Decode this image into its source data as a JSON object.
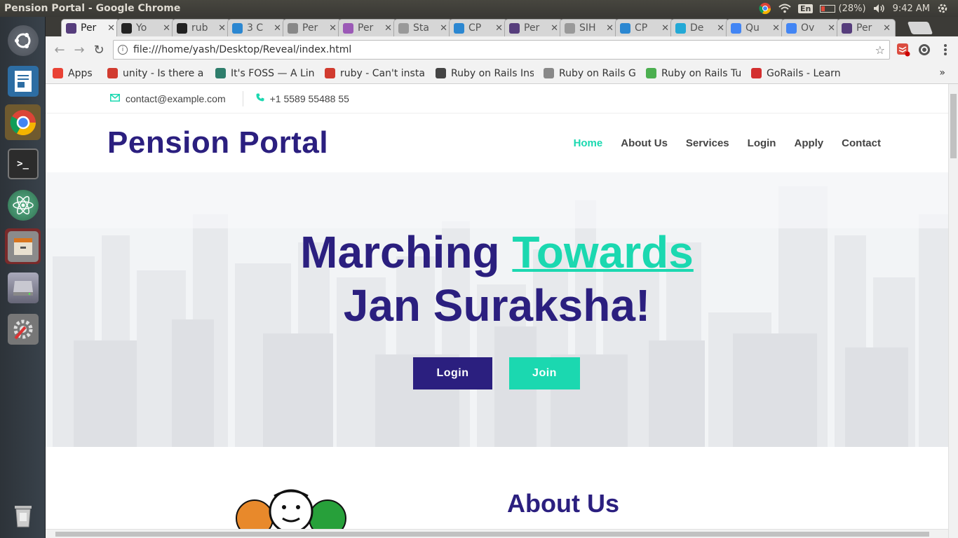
{
  "system": {
    "window_title": "Pension Portal - Google Chrome",
    "keyboard_lang": "En",
    "battery": "(28%)",
    "clock": "9:42 AM"
  },
  "launcher": {
    "items": [
      "ubuntu-dash",
      "libreoffice-writer",
      "chrome",
      "terminal",
      "atom",
      "file-manager",
      "disk-drive",
      "system-settings",
      "trash"
    ]
  },
  "browser": {
    "tabs": [
      {
        "label": "Per",
        "icon": "bootstrap-icon",
        "color": "#563d7c",
        "active": true
      },
      {
        "label": "Yo",
        "icon": "youtube-icon",
        "color": "#222222"
      },
      {
        "label": "rub",
        "icon": "github-icon",
        "color": "#222222"
      },
      {
        "label": "3 C",
        "icon": "mdb-icon",
        "color": "#2b87d1"
      },
      {
        "label": "Per",
        "icon": "emblem-icon",
        "color": "#888888"
      },
      {
        "label": "Per",
        "icon": "pension-icon",
        "color": "#9b59b6"
      },
      {
        "label": "Sta",
        "icon": "page-icon",
        "color": "#999999"
      },
      {
        "label": "CP",
        "icon": "cpanel-icon",
        "color": "#2b87d1"
      },
      {
        "label": "Per",
        "icon": "bootstrap-icon",
        "color": "#563d7c"
      },
      {
        "label": "SIH",
        "icon": "page-icon",
        "color": "#999999"
      },
      {
        "label": "CP",
        "icon": "cpanel-icon",
        "color": "#2b87d1"
      },
      {
        "label": "De",
        "icon": "m-icon",
        "color": "#23a9d6"
      },
      {
        "label": "Qu",
        "icon": "google-icon",
        "color": "#4285f4"
      },
      {
        "label": "Ov",
        "icon": "google-icon",
        "color": "#4285f4"
      },
      {
        "label": "Per",
        "icon": "bootstrap-icon",
        "color": "#563d7c"
      }
    ],
    "url": "file:///home/yash/Desktop/Reveal/index.html",
    "bookmarks": [
      {
        "label": "Apps",
        "icon": "apps-grid-icon"
      },
      {
        "label": "unity - Is there a",
        "icon": "askubuntu-icon"
      },
      {
        "label": "It's FOSS — A Lin",
        "icon": "itsfoss-icon"
      },
      {
        "label": "ruby - Can't insta",
        "icon": "askubuntu-icon"
      },
      {
        "label": "Ruby on Rails Ins",
        "icon": "diamond-icon"
      },
      {
        "label": "Ruby on Rails Gu",
        "icon": "page-icon"
      },
      {
        "label": "Ruby on Rails Tu",
        "icon": "tutorial-icon"
      },
      {
        "label": "GoRails - Learn R",
        "icon": "gorails-icon"
      }
    ],
    "bookmarks_overflow": "»"
  },
  "site": {
    "contact_email": "contact@example.com",
    "contact_phone": "+1 5589 55488 55",
    "brand": "Pension Portal",
    "nav": [
      {
        "label": "Home",
        "active": true
      },
      {
        "label": "About Us"
      },
      {
        "label": "Services"
      },
      {
        "label": "Login"
      },
      {
        "label": "Apply"
      },
      {
        "label": "Contact"
      }
    ],
    "hero": {
      "line1_a": "Marching",
      "line1_b": "Towards",
      "line2": "Jan Suraksha!",
      "login_button": "Login",
      "join_button": "Join"
    },
    "about_title": "About Us",
    "colors": {
      "primary": "#2b1f7f",
      "accent": "#1bd8b0"
    }
  }
}
